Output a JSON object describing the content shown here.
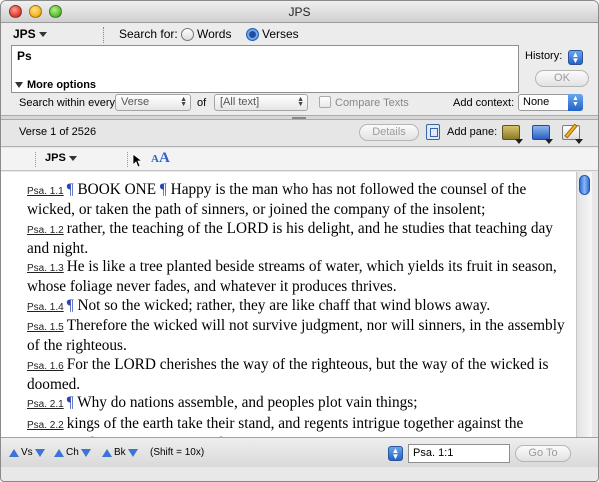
{
  "window": {
    "title": "JPS"
  },
  "search": {
    "module": "JPS",
    "search_for_label": "Search for:",
    "option_words": "Words",
    "option_verses": "Verses",
    "selected_option": "Verses",
    "query": "Ps",
    "history_label": "History:",
    "ok_label": "OK",
    "more_options_label": "More options",
    "search_within_label": "Search within every",
    "within_value": "Verse",
    "of_label": "of",
    "range_value": "[All text]",
    "compare_label": "Compare Texts",
    "add_context_label": "Add context:",
    "context_value": "None"
  },
  "results": {
    "verse_label": "Verse 1  of 2526",
    "details_label": "Details",
    "add_pane_label": "Add pane:"
  },
  "text_pane": {
    "module": "JPS",
    "font_small": "A",
    "font_big": "A",
    "verses": [
      {
        "ref": "Psa. 1.1",
        "text": "¶ BOOK ONE ¶ Happy is the man who has not followed the counsel of the wicked, or taken the path of sinners, or joined the company of the insolent;"
      },
      {
        "ref": "Psa. 1.2",
        "text": "rather, the teaching of the LORD is his delight, and he studies that teaching day and night."
      },
      {
        "ref": "Psa. 1.3",
        "text": "He is like a tree planted beside streams of water, which yields its fruit in season, whose foliage never fades, and whatever it produces thrives."
      },
      {
        "ref": "Psa. 1.4",
        "text": "¶ Not so the wicked; rather, they are like chaff that wind blows away."
      },
      {
        "ref": "Psa. 1.5",
        "text": "Therefore the wicked will not survive judgment, nor will sinners, in the assembly of the righteous."
      },
      {
        "ref": "Psa. 1.6",
        "text": "For the LORD cherishes the way of the righteous, but the way of the wicked is doomed."
      },
      {
        "ref": "Psa. 2.1",
        "text": "¶ Why do nations assemble, and peoples plot vain things;"
      },
      {
        "ref": "Psa. 2.2",
        "text": "kings of the earth take their stand, and regents intrigue together against the LORD and against His anointed?"
      }
    ]
  },
  "bottom_bar": {
    "vs_label": "Vs",
    "ch_label": "Ch",
    "bk_label": "Bk",
    "shift_note": "(Shift = 10x)",
    "goto_value": "Psa. 1:1",
    "goto_label": "Go To"
  },
  "colors": {
    "accent": "#2f62c9",
    "pilcrow": "#2a46b5"
  }
}
